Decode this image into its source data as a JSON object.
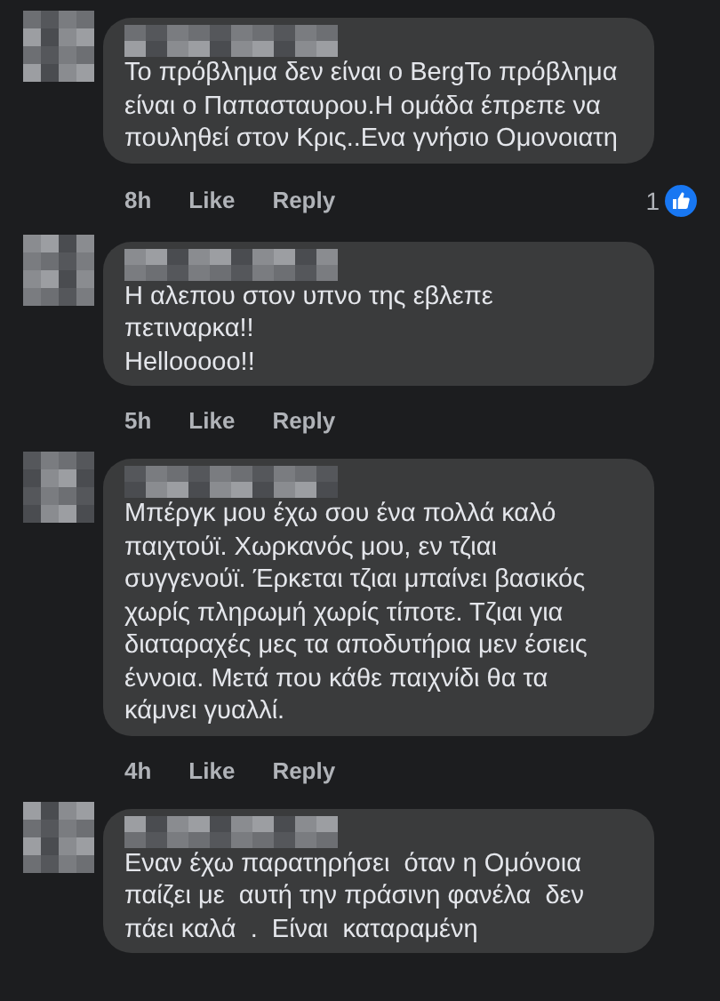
{
  "comments": [
    {
      "lines": [
        "Το πρόβλημα δεν είναι ο BergΤο πρόβλημα",
        "είναι ο Παπασταυρου.Η ομάδα έπρεπε να",
        "πουληθεί στον Κρις..Ενα γνήσιο Ομονοιατη"
      ],
      "time": "8h",
      "like": "Like",
      "reply": "Reply",
      "reactions": "1"
    },
    {
      "lines": [
        "Η αλεπου στον υπνο της εβλεπε",
        "πετιναρκα!!",
        "Hellooooo!!"
      ],
      "time": "5h",
      "like": "Like",
      "reply": "Reply"
    },
    {
      "lines": [
        "Μπέργκ μου έχω σου ένα πολλά καλό",
        "παιχτούϊ. Χωρκανός μου, εν τζιαι",
        "συγγενούϊ. Έρκεται τζιαι μπαίνει βασικός",
        "χωρίς πληρωμή χωρίς τίποτε. Τζιαι για",
        "διαταραχές μες τα αποδυτήρια μεν έσιεις",
        "έννοια. Μετά που κάθε παιχνίδι θα τα",
        "κάμνει γυαλλί."
      ],
      "time": "4h",
      "like": "Like",
      "reply": "Reply"
    },
    {
      "lines": [
        "Εναν έχω παρατηρήσει  όταν η Ομόνοια",
        "παίζει με  αυτή την πράσινη φανέλα  δεν",
        "πάει καλά  .  Είναι  καταραμένη"
      ]
    }
  ]
}
